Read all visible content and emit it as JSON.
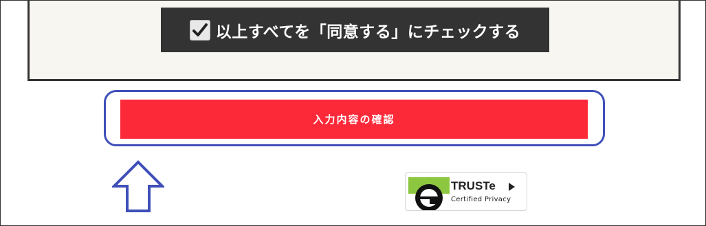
{
  "agreement": {
    "check_all_label": "以上すべてを「同意する」にチェックする"
  },
  "form": {
    "confirm_label": "入力内容の確認"
  },
  "badge": {
    "brand": "TRUSTe",
    "tagline": "Certified Privacy"
  },
  "colors": {
    "panel_border": "#333333",
    "panel_background": "#f8f6f1",
    "check_button_background": "#333333",
    "confirm_button": "#fc2939",
    "annotation_blue": "#3f4fb8",
    "truste_green": "#8dc63f"
  },
  "icons": {
    "checkbox": "checkbox-checked-icon",
    "arrow": "up-arrow-icon",
    "badge_logo": "truste-e-logo-icon",
    "badge_play": "play-triangle-icon"
  }
}
